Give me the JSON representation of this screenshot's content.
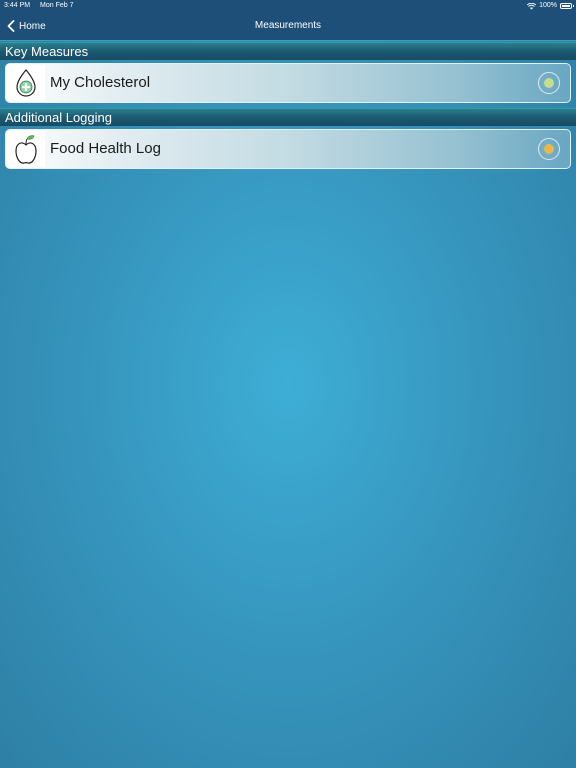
{
  "status_bar": {
    "time": "3:44 PM",
    "date": "Mon Feb 7",
    "battery": "100%"
  },
  "nav": {
    "back_label": "Home",
    "title": "Measurements"
  },
  "sections": [
    {
      "title": "Key Measures",
      "items": [
        {
          "label": "My Cholesterol",
          "icon": "cholesterol-drop-icon",
          "status_color": "#c6dd8c"
        }
      ]
    },
    {
      "title": "Additional Logging",
      "items": [
        {
          "label": "Food Health Log",
          "icon": "apple-icon",
          "status_color": "#e8b94a"
        }
      ]
    }
  ],
  "colors": {
    "navbar": "#1d4f78",
    "background": "#3797bf"
  }
}
